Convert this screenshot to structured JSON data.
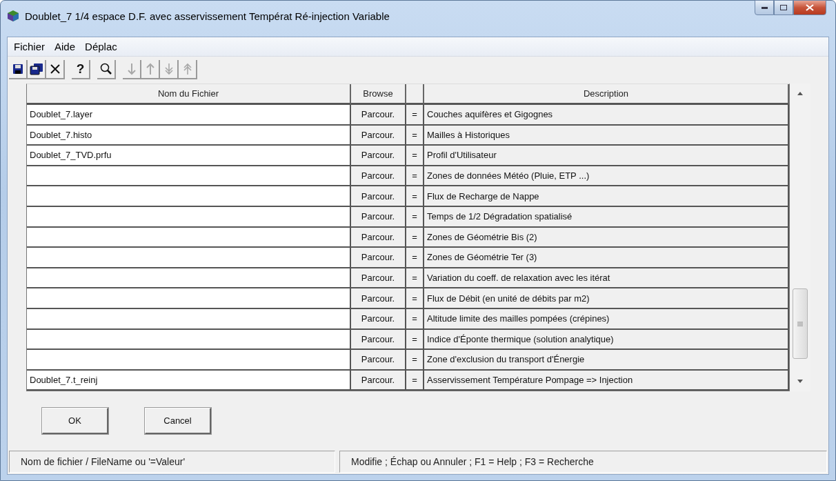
{
  "window": {
    "title": "Doublet_7 1/4 espace D.F. avec asservissement Températ Ré-injection Variable"
  },
  "menu": [
    {
      "label": "Fichier"
    },
    {
      "label": "Aide"
    },
    {
      "label": "Déplac"
    }
  ],
  "toolbar": [
    {
      "kind": "save",
      "disabled": false
    },
    {
      "kind": "save-all",
      "disabled": false
    },
    {
      "kind": "delete",
      "disabled": false
    },
    {
      "kind": "text",
      "label": "?",
      "disabled": false
    },
    {
      "kind": "search",
      "disabled": false
    },
    {
      "kind": "down",
      "disabled": true
    },
    {
      "kind": "up",
      "disabled": true
    },
    {
      "kind": "last",
      "disabled": true
    },
    {
      "kind": "first",
      "disabled": true
    }
  ],
  "table": {
    "columns": {
      "file": "Nom du Fichier",
      "browse": "Browse",
      "description": "Description"
    },
    "rows": [
      {
        "file": "Doublet_7.layer",
        "browse": "Parcour.",
        "eq": "=",
        "description": "Couches aquifères et Gigognes"
      },
      {
        "file": "Doublet_7.histo",
        "browse": "Parcour.",
        "eq": "=",
        "description": "Mailles à Historiques"
      },
      {
        "file": "Doublet_7_TVD.prfu",
        "browse": "Parcour.",
        "eq": "=",
        "description": "Profil d'Utilisateur"
      },
      {
        "browse": "Parcour.",
        "eq": "=",
        "description": "Zones de données Météo (Pluie, ETP ...)"
      },
      {
        "browse": "Parcour.",
        "eq": "=",
        "description": "Flux de Recharge de Nappe"
      },
      {
        "browse": "Parcour.",
        "eq": "=",
        "description": "Temps de 1/2 Dégradation spatialisé"
      },
      {
        "browse": "Parcour.",
        "eq": "=",
        "description": "Zones de Géométrie Bis (2)"
      },
      {
        "browse": "Parcour.",
        "eq": "=",
        "description": "Zones de Géométrie Ter (3)"
      },
      {
        "browse": "Parcour.",
        "eq": "=",
        "description": "Variation du coeff. de relaxation avec les itérat"
      },
      {
        "browse": "Parcour.",
        "eq": "=",
        "description": "Flux de Débit (en unité de débits par m2)"
      },
      {
        "browse": "Parcour.",
        "eq": "=",
        "description": "Altitude limite des mailles pompées (crépines)"
      },
      {
        "browse": "Parcour.",
        "eq": "=",
        "description": "Indice d'Éponte thermique (solution analytique)"
      },
      {
        "browse": "Parcour.",
        "eq": "=",
        "description": "Zone d'exclusion du transport d'Énergie"
      },
      {
        "file": "Doublet_7.t_reinj",
        "browse": "Parcour.",
        "eq": "=",
        "description": "Asservissement Température Pompage => Injection"
      }
    ]
  },
  "buttons": [
    {
      "label": "OK"
    },
    {
      "label": "Cancel"
    }
  ],
  "status_bar": [
    "Nom de fichier / FileName  ou   '=Valeur'",
    "Modifie ;  Échap ou Annuler  ;  F1 = Help  ;  F3 = Recherche"
  ]
}
